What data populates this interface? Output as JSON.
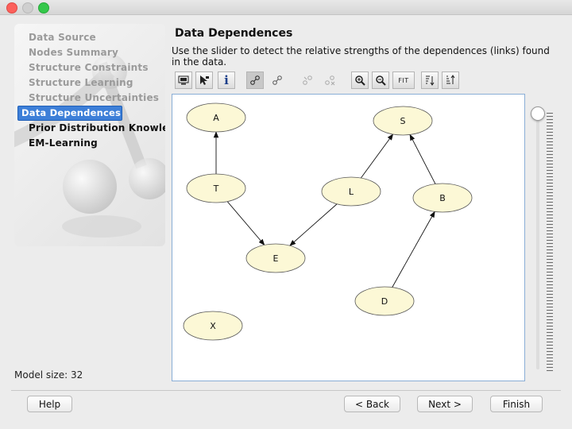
{
  "window": {
    "title": ""
  },
  "sidebar": {
    "steps": [
      {
        "label": "Data Source"
      },
      {
        "label": "Nodes Summary"
      },
      {
        "label": "Structure Constraints"
      },
      {
        "label": "Structure Learning"
      },
      {
        "label": "Structure Uncertainties"
      },
      {
        "label": "Data Dependences"
      },
      {
        "label": "Prior Distribution Knowledge"
      },
      {
        "label": "EM-Learning"
      }
    ],
    "active_index": 5,
    "model_size": "Model size: 32"
  },
  "main": {
    "title": "Data Dependences",
    "description": "Use the slider to detect the relative strengths of the dependences (links) found in the data."
  },
  "toolbar": {
    "fit_label": "FIT",
    "info_glyph": "i"
  },
  "graph": {
    "nodes": [
      {
        "id": "A",
        "label": "A"
      },
      {
        "id": "S",
        "label": "S"
      },
      {
        "id": "T",
        "label": "T"
      },
      {
        "id": "L",
        "label": "L"
      },
      {
        "id": "B",
        "label": "B"
      },
      {
        "id": "E",
        "label": "E"
      },
      {
        "id": "D",
        "label": "D"
      },
      {
        "id": "X",
        "label": "X"
      }
    ],
    "edges": [
      {
        "from": "T",
        "to": "A"
      },
      {
        "from": "T",
        "to": "E"
      },
      {
        "from": "L",
        "to": "E"
      },
      {
        "from": "L",
        "to": "S"
      },
      {
        "from": "B",
        "to": "S"
      },
      {
        "from": "D",
        "to": "B"
      }
    ],
    "node_fill": "#fcf8d6",
    "node_stroke": "#555555"
  },
  "slider": {
    "level": 1.0
  },
  "footer": {
    "help_label": "Help",
    "back_label": "< Back",
    "next_label": "Next >",
    "finish_label": "Finish"
  },
  "colors": {
    "selection": "#3d7fd8",
    "canvas_border": "#8aaed6"
  }
}
